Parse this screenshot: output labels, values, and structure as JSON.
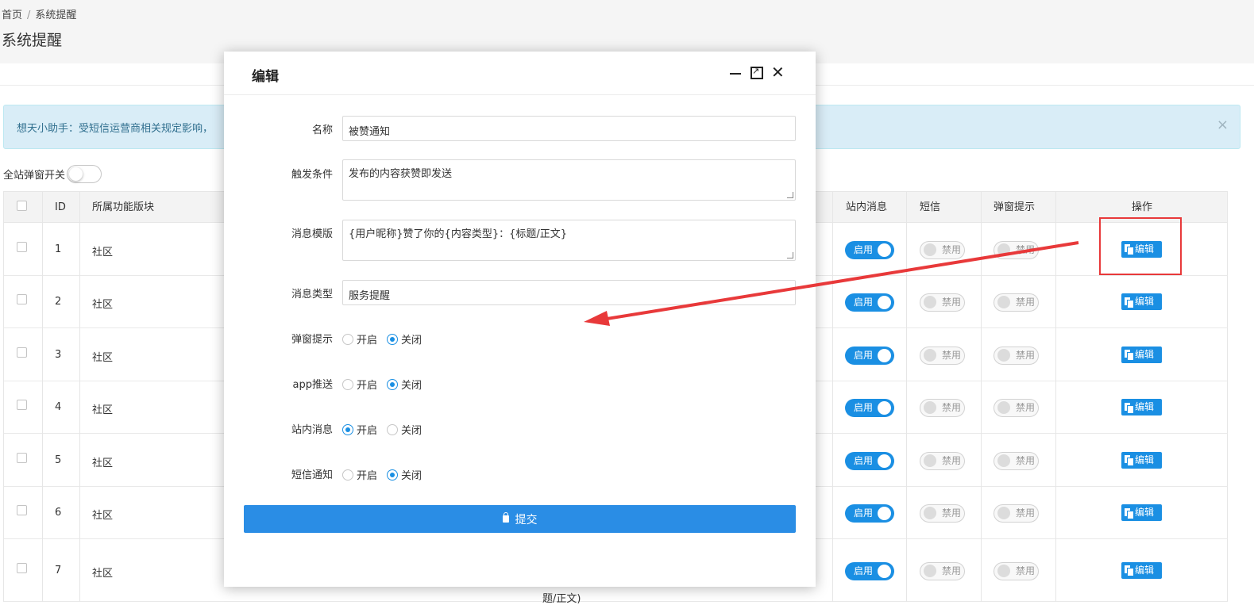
{
  "breadcrumb": {
    "home": "首页",
    "current": "系统提醒"
  },
  "page_title": "系统提醒",
  "alert": {
    "text": "想天小助手：受短信运营商相关规定影响，",
    "close": "×"
  },
  "global_popup_toggle": {
    "label": "全站弹窗开关",
    "on": false
  },
  "table": {
    "columns": [
      "ID",
      "所属功能版块",
      "站内消息",
      "短信",
      "弹窗提示",
      "操作"
    ],
    "rows": [
      {
        "id": "1",
        "module": "社区",
        "site_msg": "启用",
        "sms": "禁用",
        "popup": "禁用",
        "action": "编辑"
      },
      {
        "id": "2",
        "module": "社区",
        "site_msg": "启用",
        "sms": "禁用",
        "popup": "禁用",
        "action": "编辑"
      },
      {
        "id": "3",
        "module": "社区",
        "site_msg": "启用",
        "sms": "禁用",
        "popup": "禁用",
        "action": "编辑"
      },
      {
        "id": "4",
        "module": "社区",
        "site_msg": "启用",
        "sms": "禁用",
        "popup": "禁用",
        "action": "编辑"
      },
      {
        "id": "5",
        "module": "社区",
        "site_msg": "启用",
        "sms": "禁用",
        "popup": "禁用",
        "action": "编辑"
      },
      {
        "id": "6",
        "module": "社区",
        "site_msg": "启用",
        "sms": "禁用",
        "popup": "禁用",
        "action": "编辑"
      },
      {
        "id": "7",
        "module": "社区",
        "site_msg": "启用",
        "sms": "禁用",
        "popup": "禁用",
        "action": "编辑"
      }
    ],
    "overflow_text": "题/正文)"
  },
  "modal": {
    "title": "编辑",
    "fields": {
      "name": {
        "label": "名称",
        "value": "被赞通知"
      },
      "trigger": {
        "label": "触发条件",
        "value": "发布的内容获赞即发送"
      },
      "template": {
        "label": "消息模版",
        "value": "{用户昵称}赞了你的{内容类型}：{标题/正文}"
      },
      "msg_type": {
        "label": "消息类型",
        "value": "服务提醒"
      },
      "popup": {
        "label": "弹窗提示",
        "on": "开启",
        "off": "关闭",
        "selected": "off"
      },
      "app_push": {
        "label": "app推送",
        "on": "开启",
        "off": "关闭",
        "selected": "off"
      },
      "site_msg": {
        "label": "站内消息",
        "on": "开启",
        "off": "关闭",
        "selected": "on"
      },
      "sms": {
        "label": "短信通知",
        "on": "开启",
        "off": "关闭",
        "selected": "off"
      }
    },
    "submit_label": "提交"
  },
  "colors": {
    "primary": "#1a8fe3",
    "annotation": "#e8393a",
    "alert_bg": "#d9edf7"
  }
}
